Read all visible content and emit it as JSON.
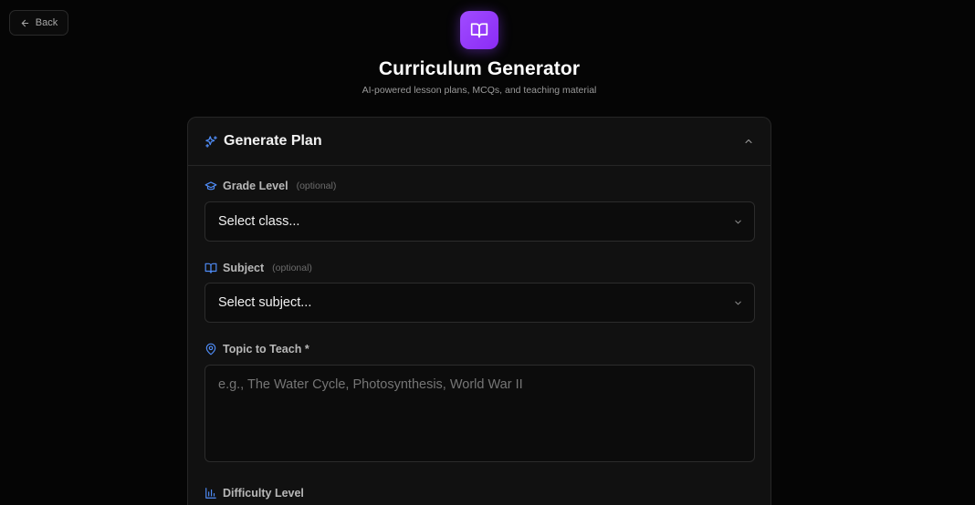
{
  "back": {
    "label": "Back",
    "icon": "arrow-left-icon"
  },
  "hero": {
    "icon": "book-open-icon",
    "accent": "#9b3ff9",
    "title": "Curriculum Generator",
    "subtitle": "AI-powered lesson plans, MCQs, and teaching material"
  },
  "card": {
    "title": "Generate Plan",
    "title_icon": "sparkles-icon",
    "collapse_icon": "chevron-up-icon",
    "fields": {
      "grade": {
        "label": "Grade Level",
        "optional": "(optional)",
        "icon": "graduation-cap-icon",
        "value": "Select class..."
      },
      "subject": {
        "label": "Subject",
        "optional": "(optional)",
        "icon": "book-open-icon",
        "value": "Select subject..."
      },
      "topic": {
        "label": "Topic to Teach *",
        "icon": "map-pin-icon",
        "placeholder": "e.g., The Water Cycle, Photosynthesis, World War II",
        "value": ""
      },
      "difficulty": {
        "label": "Difficulty Level",
        "icon": "bar-chart-icon"
      }
    }
  },
  "colors": {
    "background": "#050505",
    "card": "#111111",
    "icon_blue": "#4f8cf7"
  }
}
